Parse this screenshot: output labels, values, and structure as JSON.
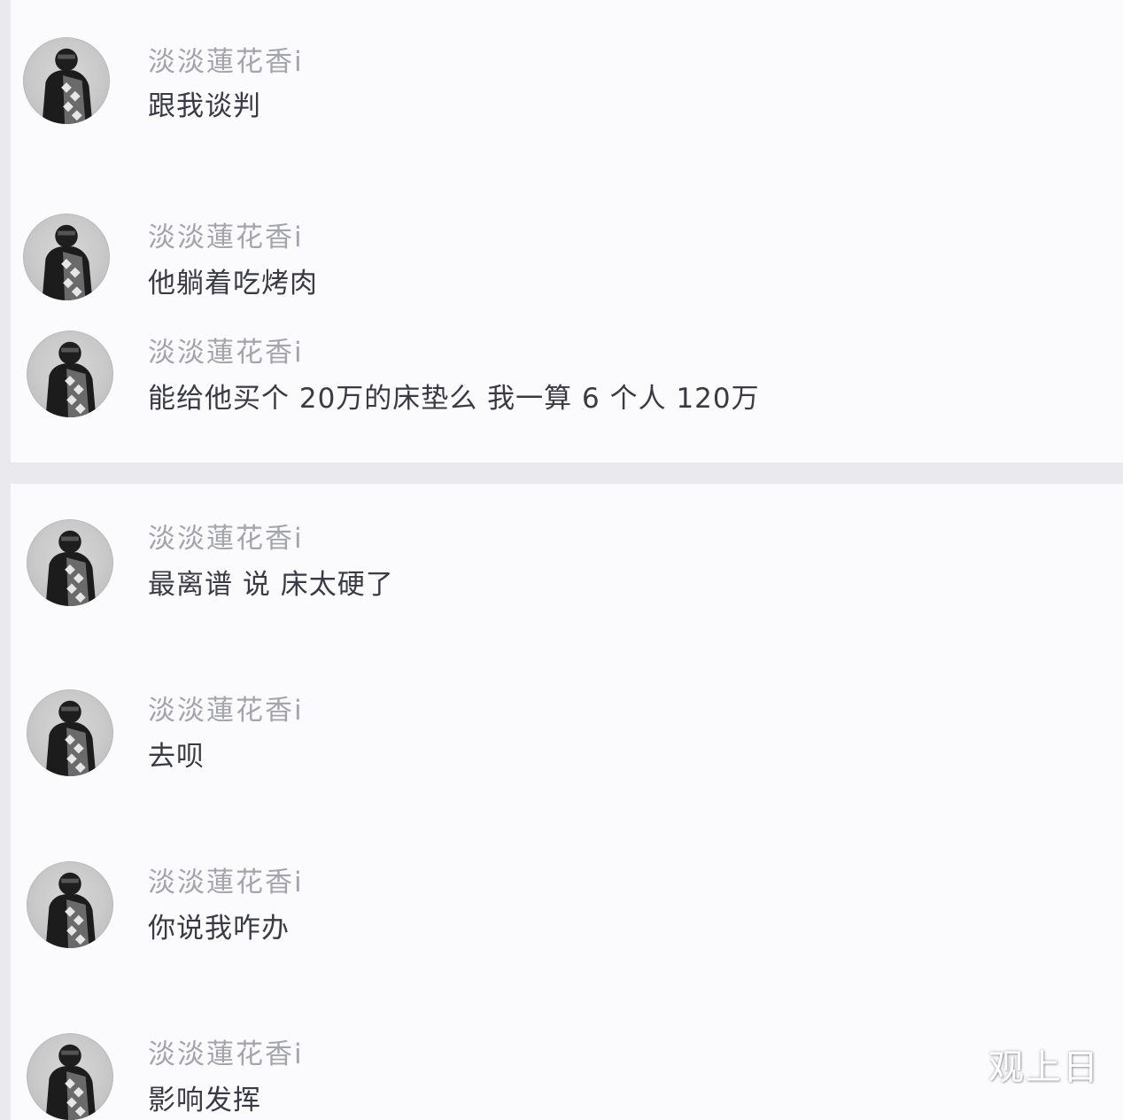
{
  "comments": [
    {
      "username": "淡淡蓮花香ⅰ",
      "text": "跟我谈判"
    },
    {
      "username": "淡淡蓮花香ⅰ",
      "text": "他躺着吃烤肉"
    },
    {
      "username": "淡淡蓮花香ⅰ",
      "text": "能给他买个 20万的床垫么  我一算 6 个人  120万"
    },
    {
      "username": "淡淡蓮花香ⅰ",
      "text": "最离谱 说 床太硬了"
    },
    {
      "username": "淡淡蓮花香ⅰ",
      "text": "去呗"
    },
    {
      "username": "淡淡蓮花香ⅰ",
      "text": "你说我咋办"
    },
    {
      "username": "淡淡蓮花香ⅰ",
      "text": "影响发挥"
    }
  ],
  "watermark": "观上日"
}
